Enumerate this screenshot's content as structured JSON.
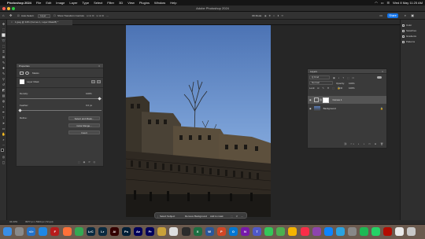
{
  "menubar": {
    "app_name": "Photoshop 2024",
    "items": [
      "File",
      "Edit",
      "Image",
      "Layer",
      "Type",
      "Select",
      "Filter",
      "3D",
      "View",
      "Plugins",
      "Window",
      "Help"
    ],
    "clock": "Wed 8 May 11:25 AM"
  },
  "window": {
    "title": "Adobe Photoshop 2024"
  },
  "options": {
    "auto_select_label": "Auto-Select:",
    "auto_select_value": "Layer",
    "transform_controls": "Show Transform Controls",
    "mode_3d": "3D Mode:",
    "share_label": "Share"
  },
  "document": {
    "tab_title": "1.jpeg @ 34% (Curves 1, Layer Mask/8) *"
  },
  "properties": {
    "title": "Properties",
    "section": "Masks",
    "layer_mask_label": "Layer Mask",
    "density_label": "Density:",
    "density_value": "100%",
    "feather_label": "Feather:",
    "feather_value": "0.0 px",
    "refine_label": "Refine:",
    "select_and_mask": "Select and Mask...",
    "color_range": "Color Range...",
    "invert": "Invert"
  },
  "layers": {
    "title": "Layers",
    "kind_label": "Q Kind",
    "blend_mode": "Normal",
    "opacity_label": "Opacity:",
    "opacity_value": "100%",
    "lock_label": "Lock:",
    "fill_label": "Fill:",
    "fill_value": "100%",
    "items": [
      {
        "name": "Curves 1",
        "selected": true
      },
      {
        "name": "Background",
        "selected": false
      }
    ]
  },
  "rightdock": {
    "items": [
      "Color",
      "Swatches",
      "Gradients",
      "Patterns"
    ]
  },
  "taskbar": {
    "select_subject": "Select Subject",
    "remove_background": "Remove Background",
    "add_to_mask": "Add to mask"
  },
  "statusbar": {
    "zoom": "34.03%",
    "doc_info": "3977 px x 5304 px (72 ppi)"
  },
  "dock": {
    "apps": [
      {
        "name": "Finder",
        "label": "",
        "color": "#3a8ee6"
      },
      {
        "name": "Launchpad",
        "label": "",
        "color": "#8a8a8a"
      },
      {
        "name": "VS Code",
        "label": "</>",
        "color": "#2472c8"
      },
      {
        "name": "Safari",
        "label": "",
        "color": "#1e88e5"
      },
      {
        "name": "FileZilla",
        "label": "F",
        "color": "#b71c1c"
      },
      {
        "name": "Firefox",
        "label": "",
        "color": "#ff7139"
      },
      {
        "name": "Chrome",
        "label": "",
        "color": "#34a853"
      },
      {
        "name": "Lightroom Classic",
        "label": "LrC",
        "color": "#0a2a3f"
      },
      {
        "name": "Lightroom",
        "label": "Lr",
        "color": "#0a2a3f"
      },
      {
        "name": "Illustrator",
        "label": "Ai",
        "color": "#330000"
      },
      {
        "name": "Photoshop",
        "label": "Ps",
        "color": "#001e36"
      },
      {
        "name": "After Effects",
        "label": "Ae",
        "color": "#00005b"
      },
      {
        "name": "Premiere Pro",
        "label": "Pr",
        "color": "#00005b"
      },
      {
        "name": "Illustrator 2",
        "label": "",
        "color": "#c9a13a"
      },
      {
        "name": "Files",
        "label": "",
        "color": "#dddddd"
      },
      {
        "name": "Terminal",
        "label": "",
        "color": "#2b2b2b"
      },
      {
        "name": "Excel",
        "label": "X",
        "color": "#1d6f42"
      },
      {
        "name": "Word",
        "label": "W",
        "color": "#2b579a"
      },
      {
        "name": "PowerPoint",
        "label": "P",
        "color": "#d24726"
      },
      {
        "name": "Outlook",
        "label": "O",
        "color": "#0078d4"
      },
      {
        "name": "OneNote",
        "label": "N",
        "color": "#7719aa"
      },
      {
        "name": "Teams",
        "label": "T",
        "color": "#5059c9"
      },
      {
        "name": "Messages",
        "label": "",
        "color": "#34c759"
      },
      {
        "name": "Maps",
        "label": "",
        "color": "#4caf50"
      },
      {
        "name": "Photos",
        "label": "",
        "color": "#f4b400"
      },
      {
        "name": "Music",
        "label": "",
        "color": "#fa2d48"
      },
      {
        "name": "Podcasts",
        "label": "",
        "color": "#8e44ad"
      },
      {
        "name": "App Store",
        "label": "",
        "color": "#0d84ff"
      },
      {
        "name": "Telegram",
        "label": "",
        "color": "#2aa3e0"
      },
      {
        "name": "Settings",
        "label": "",
        "color": "#888888"
      },
      {
        "name": "Spotify",
        "label": "",
        "color": "#1db954"
      },
      {
        "name": "WhatsApp",
        "label": "",
        "color": "#25d366"
      },
      {
        "name": "Acrobat",
        "label": "",
        "color": "#b30b00"
      },
      {
        "name": "Folder",
        "label": "",
        "color": "#e9e9e9"
      },
      {
        "name": "Trash",
        "label": "",
        "color": "#c8c8c8"
      }
    ]
  }
}
